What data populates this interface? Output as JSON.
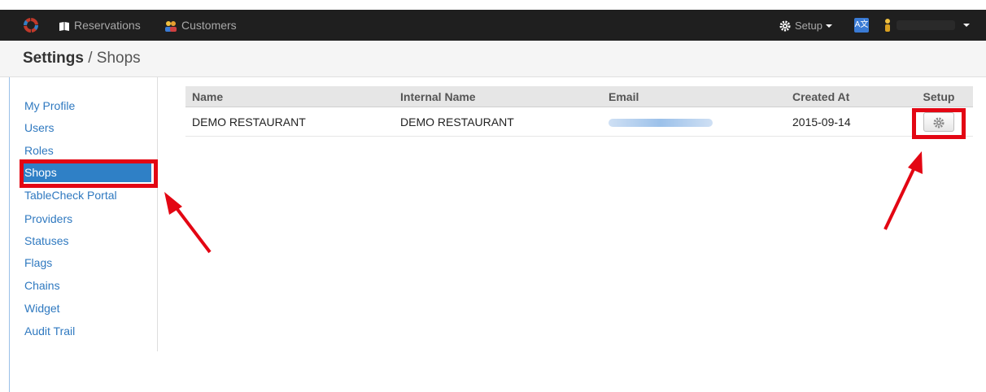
{
  "navbar": {
    "reservations": "Reservations",
    "customers": "Customers",
    "setup": "Setup",
    "translate_glyph": "A文"
  },
  "page": {
    "title_bold": "Settings",
    "title_sep": " / ",
    "title_sub": "Shops"
  },
  "sidebar": {
    "items": [
      {
        "label": "My Profile"
      },
      {
        "label": "Users"
      },
      {
        "label": "Roles"
      },
      {
        "label": "Shops"
      },
      {
        "label": "TableCheck Portal"
      },
      {
        "label": "Providers"
      },
      {
        "label": "Statuses"
      },
      {
        "label": "Flags"
      },
      {
        "label": "Chains"
      },
      {
        "label": "Widget"
      },
      {
        "label": "Audit Trail"
      }
    ],
    "active_index": 3
  },
  "table": {
    "headers": [
      "Name",
      "Internal Name",
      "Email",
      "Created At",
      "Setup"
    ],
    "rows": [
      {
        "name": "DEMO RESTAURANT",
        "internal_name": "DEMO RESTAURANT",
        "created_at": "2015-09-14"
      }
    ]
  },
  "colors": {
    "navbar_bg": "#1f1f1f",
    "link": "#2f79c0",
    "active_bg": "#2f80c6",
    "annotation": "#e30613"
  },
  "icons": [
    "logo-icon",
    "book-icon",
    "users-icon",
    "gear-icon",
    "translate-icon",
    "user-icon",
    "chevron-down-icon",
    "arrow-icon"
  ]
}
